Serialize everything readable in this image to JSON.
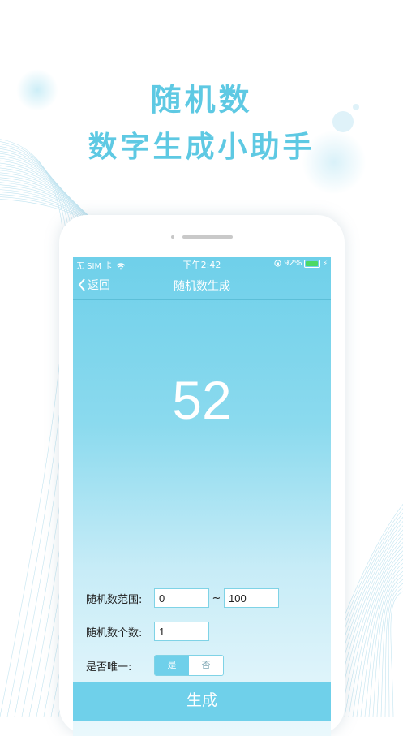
{
  "hero": {
    "title": "随机数",
    "subtitle": "数字生成小助手"
  },
  "statusbar": {
    "carrier": "无 SIM 卡",
    "time": "下午2:42",
    "battery": "92%",
    "battery_level": 0.92
  },
  "navbar": {
    "back_label": "返回",
    "title": "随机数生成"
  },
  "result": {
    "value": "52"
  },
  "form": {
    "range_label": "随机数范围:",
    "range_min": "0",
    "range_sep": "~",
    "range_max": "100",
    "count_label": "随机数个数:",
    "count_value": "1",
    "unique_label": "是否唯一:",
    "unique_yes": "是",
    "unique_no": "否",
    "unique_selected": "是"
  },
  "generate_label": "生成",
  "colors": {
    "accent": "#6fd0ea",
    "title": "#5ec9e3",
    "battery": "#4cd964"
  }
}
